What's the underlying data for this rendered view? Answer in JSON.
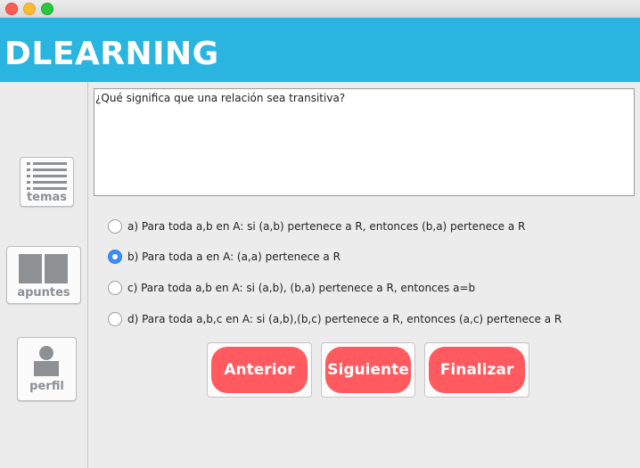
{
  "window": {
    "controls": [
      "close",
      "minimize",
      "zoom"
    ]
  },
  "header": {
    "brand": "DLEARNING",
    "color": "#2ab5e0"
  },
  "sidebar": {
    "items": [
      {
        "label": "temas",
        "icon": "list-icon"
      },
      {
        "label": "apuntes",
        "icon": "book-icon"
      },
      {
        "label": "perfil",
        "icon": "user-icon"
      }
    ]
  },
  "question": {
    "text": "¿Qué significa que una relación sea transitiva?"
  },
  "options": [
    {
      "label": "a) Para toda a,b en A: si (a,b) pertenece a R, entonces (b,a) pertenece a R",
      "selected": false
    },
    {
      "label": "b) Para toda a en A: (a,a) pertenece a R",
      "selected": true
    },
    {
      "label": "c) Para toda a,b en A: si (a,b), (b,a) pertenece a R, entonces a=b",
      "selected": false
    },
    {
      "label": "d) Para toda a,b,c en A: si (a,b),(b,c) pertenece a R, entonces (a,c) pertenece a R",
      "selected": false
    }
  ],
  "buttons": {
    "previous": "Anterior",
    "next": "Siguiente",
    "finish": "Finalizar",
    "color": "#ff5a5f"
  }
}
